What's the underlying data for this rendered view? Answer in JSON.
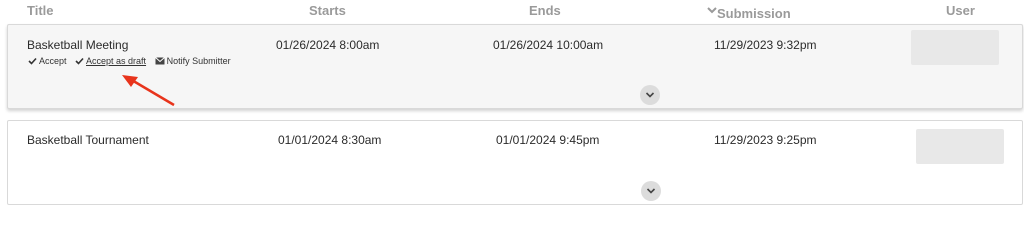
{
  "header": {
    "title": "Title",
    "starts": "Starts",
    "ends": "Ends",
    "submission_date": "Submission Date",
    "user": "User",
    "sort_icon": "chevron-down-icon"
  },
  "rows": [
    {
      "title": "Basketball Meeting",
      "starts": "01/26/2024 8:00am",
      "ends": "01/26/2024 10:00am",
      "submission_date": "11/29/2023 9:32pm",
      "actions": {
        "accept": "Accept",
        "accept_as_draft": "Accept as draft",
        "notify_submitter": "Notify Submitter"
      },
      "expanded": true
    },
    {
      "title": "Basketball Tournament",
      "starts": "01/01/2024 8:30am",
      "ends": "01/01/2024 9:45pm",
      "submission_date": "11/29/2023 9:25pm",
      "expanded": false
    }
  ],
  "colors": {
    "header_text": "#9a9a9a",
    "active_row_bg": "#f6f6f6",
    "annotation_arrow": "#e8341c"
  }
}
